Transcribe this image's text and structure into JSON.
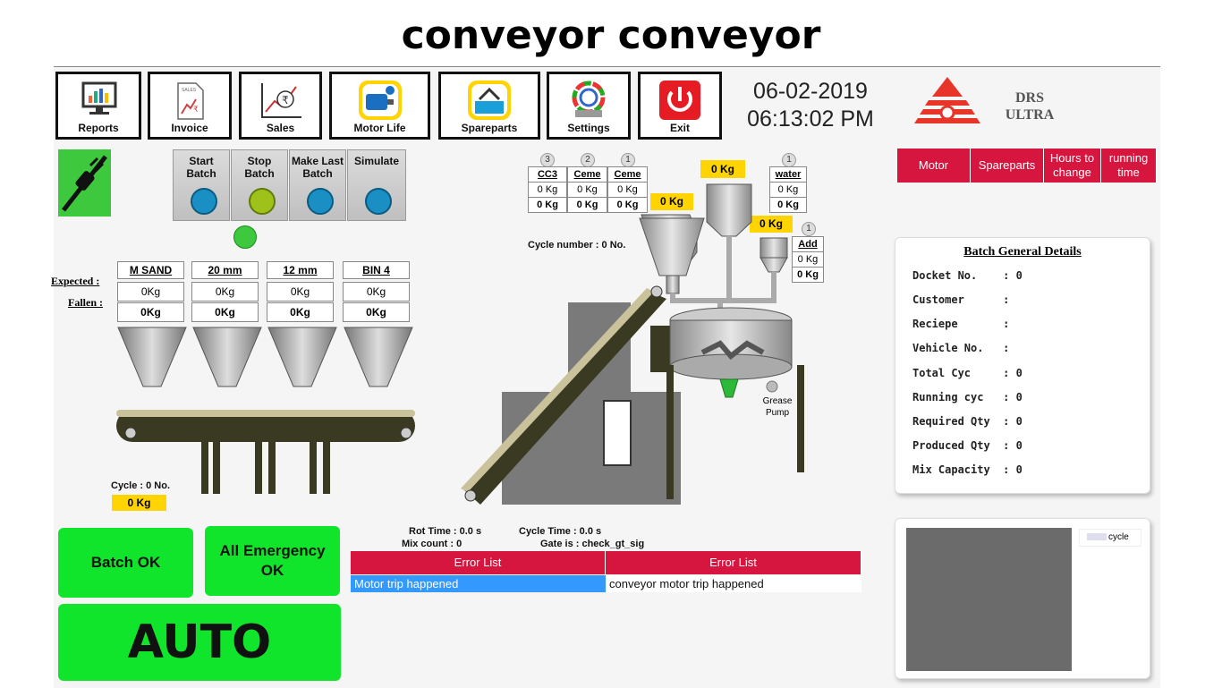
{
  "title": "conveyor conveyor",
  "toolbar": [
    {
      "label": "Reports",
      "icon": "reports-icon"
    },
    {
      "label": "Invoice",
      "icon": "invoice-icon"
    },
    {
      "label": "Sales",
      "icon": "sales-icon"
    },
    {
      "label": "Motor Life",
      "icon": "motor-life-icon"
    },
    {
      "label": "Spareparts",
      "icon": "spareparts-icon"
    },
    {
      "label": "Settings",
      "icon": "settings-icon"
    },
    {
      "label": "Exit",
      "icon": "power-icon"
    }
  ],
  "invoice_icon_text": "SALES",
  "datetime": {
    "date": "06-02-2019",
    "time": "06:13:02 PM"
  },
  "brand": {
    "line1": "DRS",
    "line2": "ULTRA"
  },
  "right_tabs": [
    "Motor",
    "Spareparts",
    "Hours to change",
    "running time"
  ],
  "controls": [
    {
      "label": "Start Batch",
      "color": "#1a8fc4"
    },
    {
      "label": "Stop Batch",
      "color": "#9fc21a"
    },
    {
      "label": "Make Last Batch",
      "color": "#1a8fc4"
    },
    {
      "label": "Simulate",
      "color": "#1a8fc4"
    }
  ],
  "bins": {
    "expected_label": "Expected :",
    "fallen_label": "Fallen :",
    "items": [
      {
        "name": "M SAND",
        "expected": "0Kg",
        "fallen": "0Kg"
      },
      {
        "name": "20 mm",
        "expected": "0Kg",
        "fallen": "0Kg"
      },
      {
        "name": "12 mm",
        "expected": "0Kg",
        "fallen": "0Kg"
      },
      {
        "name": "BIN 4",
        "expected": "0Kg",
        "fallen": "0Kg"
      }
    ]
  },
  "cycle_label": "Cycle  : 0 No.",
  "cycle_kg": "0 Kg",
  "cement_tables": [
    {
      "num": "3",
      "name": "CC3",
      "expected": "0 Kg",
      "fallen": "0 Kg"
    },
    {
      "num": "2",
      "name": "Ceme",
      "expected": "0 Kg",
      "fallen": "0 Kg"
    },
    {
      "num": "1",
      "name": "Ceme",
      "expected": "0 Kg",
      "fallen": "0 Kg"
    }
  ],
  "water": {
    "num": "1",
    "name": "water",
    "expected": "0 Kg",
    "fallen": "0 Kg"
  },
  "add": {
    "num": "1",
    "name": "Add",
    "expected": "0 Kg",
    "fallen": "0 Kg"
  },
  "scale_values": {
    "cement_scale": "0 Kg",
    "water_scale": "0 Kg",
    "add_scale": "0 Kg",
    "left_scale": "0 Kg"
  },
  "cycle_number": "Cycle number : 0 No.",
  "grease_pump": "Grease Pump",
  "status": {
    "rot_time": "Rot Time : 0.0 s",
    "cycle_time": "Cycle Time : 0.0 s",
    "mix_count": "Mix count : 0",
    "gate": "Gate is : check_gt_sig"
  },
  "errors": {
    "headers": [
      "Error List",
      "Error List"
    ],
    "rows": [
      "Motor trip happened",
      "conveyor motor trip happened"
    ]
  },
  "buttons": {
    "batch_ok": "Batch OK",
    "emergency": "All Emergency OK",
    "auto": "AUTO"
  },
  "batch_details": {
    "title": "Batch General Details",
    "rows": [
      "Docket No.    : 0",
      "Customer      :",
      "Reciepe       :",
      "Vehicle No.   :",
      "Total Cyc     : 0",
      "Running cyc   : 0",
      "Required Qty  : 0",
      "Produced Qty  : 0",
      "Mix Capacity  : 0"
    ]
  },
  "chart_legend": "cycle",
  "colors": {
    "accent_red": "#d6163f",
    "status_green": "#10e52c",
    "weight_yellow": "#ffd400",
    "error_blue": "#3399ff"
  }
}
